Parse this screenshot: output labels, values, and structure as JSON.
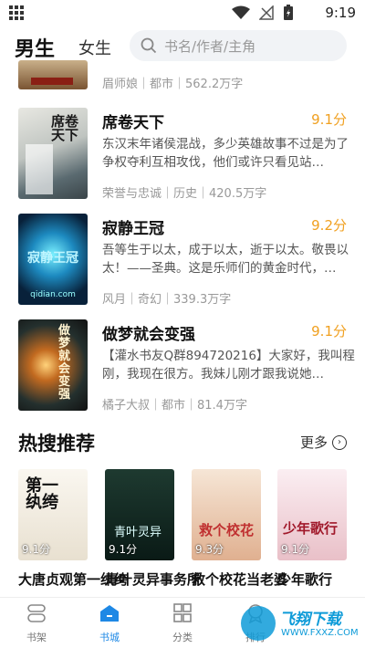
{
  "status": {
    "time": "9:19"
  },
  "tabs": {
    "male": "男生",
    "female": "女生"
  },
  "search": {
    "placeholder": "书名/作者/主角"
  },
  "prev_book": {
    "meta": "眉师娘｜都市｜562.2万字"
  },
  "books": [
    {
      "title": "席卷天下",
      "score": "9.1分",
      "desc": "东汉末年诸侯混战，多少英雄故事不过是为了争权夺利互相攻伐，他们或许只看见站…",
      "meta": "荣誉与忠诚｜历史｜420.5万字"
    },
    {
      "title": "寂静王冠",
      "score": "9.2分",
      "desc": "吾等生于以太，成于以太，逝于以太。敬畏以太！——圣典。这是乐师们的黄金时代，…",
      "meta": "风月｜奇幻｜339.3万字",
      "cover_site": "qidian.com"
    },
    {
      "title": "做梦就会变强",
      "score": "9.1分",
      "desc": "【灌水书友Q群894720216】大家好，我叫程刚，我现在很方。我妹儿刚才跟我说她…",
      "meta": "橘子大叔｜都市｜81.4万字"
    }
  ],
  "hot_section": {
    "heading": "热搜推荐",
    "more": "更多"
  },
  "hot_books": [
    {
      "title": "大唐贞观第一纨绔",
      "score": "9.1分"
    },
    {
      "title": "青叶灵异事务所",
      "score": "9.1分"
    },
    {
      "title": "救个校花当老婆",
      "score": "9.3分"
    },
    {
      "title": "少年歌行",
      "score": "9.1分"
    }
  ],
  "nav": [
    {
      "label": "书架",
      "icon": "bookshelf-icon"
    },
    {
      "label": "书城",
      "icon": "store-icon",
      "active": true
    },
    {
      "label": "分类",
      "icon": "category-icon"
    },
    {
      "label": "排行",
      "icon": "rank-icon"
    }
  ],
  "watermark": {
    "title": "飞翔下载",
    "url": "WWW.FXXZ.COM"
  },
  "colors": {
    "accent": "#1e88e5",
    "score": "#f0a020",
    "underline": "#2a90e8"
  }
}
